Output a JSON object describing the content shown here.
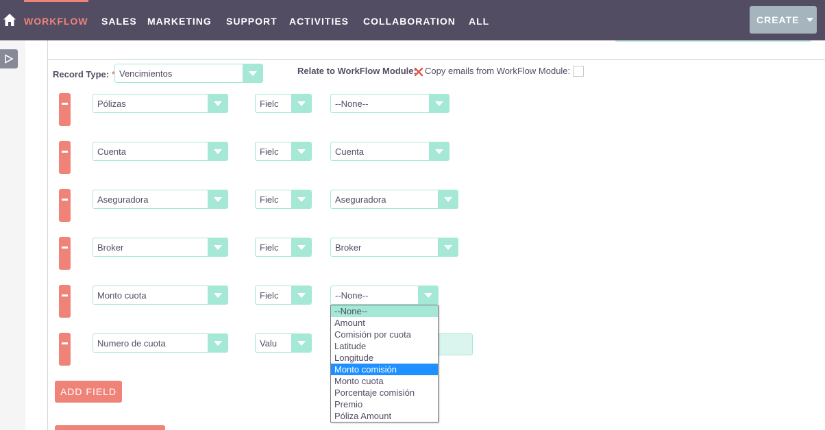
{
  "nav": {
    "items": [
      "WORKFLOW",
      "SALES",
      "MARKETING",
      "SUPPORT",
      "ACTIVITIES",
      "COLLABORATION",
      "ALL"
    ],
    "create_label": "CREATE",
    "accent_color": "#f08377",
    "bg_color": "#534d64"
  },
  "form": {
    "record_type_label": "Record Type:",
    "required_mark": "*",
    "record_type_value": "Vencimientos",
    "relate_label": "Relate to WorkFlow Module:",
    "copy_emails_label": "Copy emails from WorkFlow Module:",
    "rows": [
      {
        "field": "Pólizas",
        "type": "Fielc",
        "value": "--None--"
      },
      {
        "field": "Cuenta",
        "type": "Fielc",
        "value": "Cuenta"
      },
      {
        "field": "Aseguradora",
        "type": "Fielc",
        "value": "Aseguradora"
      },
      {
        "field": "Broker",
        "type": "Fielc",
        "value": "Broker"
      },
      {
        "field": "Monto cuota",
        "type": "Fielc",
        "value": "--None--"
      },
      {
        "field": "Numero de cuota",
        "type": "Valu",
        "value": ""
      }
    ],
    "add_field_label": "ADD FIELD"
  },
  "dropdown": {
    "options": [
      "--None--",
      "Amount",
      "Comisión por cuota",
      "Latitude",
      "Longitude",
      "Monto comisión",
      "Monto cuota",
      "Porcentaje comisión",
      "Premio",
      "Póliza Amount"
    ],
    "selected_index": 0,
    "highlighted_index": 5
  }
}
